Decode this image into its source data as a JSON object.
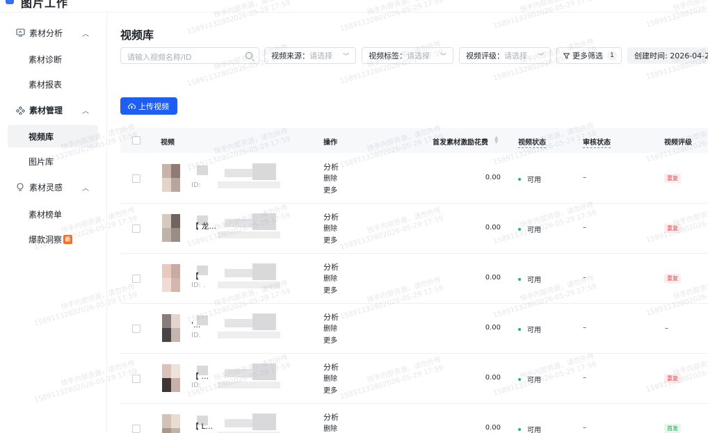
{
  "app": {
    "title": "图片工作"
  },
  "sidebar": {
    "groups": [
      {
        "label": "素材分析",
        "icon": "monitor-chart-icon",
        "items": [
          {
            "label": "素材诊断"
          },
          {
            "label": "素材报表"
          }
        ]
      },
      {
        "label": "素材管理",
        "icon": "grid-manage-icon",
        "items": [
          {
            "label": "视频库",
            "active": true
          },
          {
            "label": "图片库"
          }
        ]
      },
      {
        "label": "素材灵感",
        "icon": "bulb-icon",
        "items": [
          {
            "label": "素材榜单"
          },
          {
            "label": "爆款洞察",
            "badge": "新"
          }
        ]
      }
    ]
  },
  "main": {
    "title": "视频库",
    "search": {
      "placeholder": "请输入视频名称/ID"
    },
    "filters": [
      {
        "label": "视频来源：",
        "placeholder": "请选择"
      },
      {
        "label": "视频标签：",
        "placeholder": "请选择"
      },
      {
        "label": "视频评级：",
        "placeholder": "请选择"
      }
    ],
    "more_filters": {
      "label": "更多筛选",
      "count": "1"
    },
    "date_filter": {
      "label": "创建时间: 2026-04-2"
    },
    "upload_button": "上传视频"
  },
  "table": {
    "columns": {
      "video": "视频",
      "actions": "操作",
      "cost": "首发素材激励花费",
      "status": "视频状态",
      "review": "审核状态",
      "rating": "视频评级"
    },
    "rows": [
      {
        "title": "",
        "id": "ID:",
        "actions": [
          "分析",
          "删除",
          "更多"
        ],
        "cost": "0.00",
        "status": "可用",
        "review": "–",
        "rating": "重复",
        "rating_type": "dup"
      },
      {
        "title": "【 龙...",
        "id": "",
        "actions": [
          "分析",
          "删除",
          "更多"
        ],
        "cost": "0.00",
        "status": "可用",
        "review": "–",
        "rating": "重复",
        "rating_type": "dup"
      },
      {
        "title": "【",
        "id": "ID: .",
        "actions": [
          "分析",
          "删除",
          "更多"
        ],
        "cost": "0.00",
        "status": "可用",
        "review": "–",
        "rating": "重复",
        "rating_type": "dup"
      },
      {
        "title": "'...",
        "id": "ID.",
        "actions": [
          "分析",
          "删除",
          "更多"
        ],
        "cost": "0.00",
        "status": "可用",
        "review": "–",
        "rating": "–",
        "rating_type": "none"
      },
      {
        "title": "【 ...",
        "id": "ID:",
        "actions": [
          "分析",
          "删除",
          "更多"
        ],
        "cost": "0.00",
        "status": "可用",
        "review": "–",
        "rating": "重复",
        "rating_type": "dup"
      },
      {
        "title": "【 L...",
        "id": "",
        "actions": [
          "分析",
          "删除"
        ],
        "cost": "0.00",
        "status": "可用",
        "review": "–",
        "rating": "首发",
        "rating_type": "first"
      }
    ]
  },
  "watermark": {
    "line1": "快手内部资源，请勿外传",
    "line2": "15891132802026-05-29 17:59"
  }
}
